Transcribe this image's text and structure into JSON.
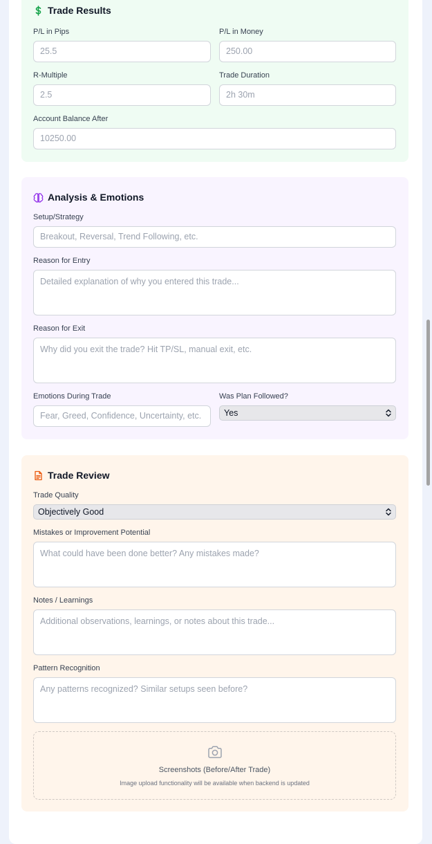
{
  "results": {
    "title": "Trade Results",
    "pl_pips": {
      "label": "P/L in Pips",
      "placeholder": "25.5"
    },
    "pl_money": {
      "label": "P/L in Money",
      "placeholder": "250.00"
    },
    "r_multiple": {
      "label": "R-Multiple",
      "placeholder": "2.5"
    },
    "duration": {
      "label": "Trade Duration",
      "placeholder": "2h 30m"
    },
    "balance": {
      "label": "Account Balance After",
      "placeholder": "10250.00"
    }
  },
  "analysis": {
    "title": "Analysis & Emotions",
    "setup": {
      "label": "Setup/Strategy",
      "placeholder": "Breakout, Reversal, Trend Following, etc."
    },
    "entry_reason": {
      "label": "Reason for Entry",
      "placeholder": "Detailed explanation of why you entered this trade..."
    },
    "exit_reason": {
      "label": "Reason for Exit",
      "placeholder": "Why did you exit the trade? Hit TP/SL, manual exit, etc."
    },
    "emotions": {
      "label": "Emotions During Trade",
      "placeholder": "Fear, Greed, Confidence, Uncertainty, etc."
    },
    "plan_followed": {
      "label": "Was Plan Followed?",
      "value": "Yes"
    }
  },
  "review": {
    "title": "Trade Review",
    "quality": {
      "label": "Trade Quality",
      "value": "Objectively Good"
    },
    "mistakes": {
      "label": "Mistakes or Improvement Potential",
      "placeholder": "What could have been done better? Any mistakes made?"
    },
    "notes": {
      "label": "Notes / Learnings",
      "placeholder": "Additional observations, learnings, or notes about this trade..."
    },
    "patterns": {
      "label": "Pattern Recognition",
      "placeholder": "Any patterns recognized? Similar setups seen before?"
    },
    "screenshots": {
      "title": "Screenshots (Before/After Trade)",
      "note": "Image upload functionality will be available when backend is updated"
    }
  },
  "icons": {
    "results": "dollar-icon",
    "analysis": "brain-icon",
    "review": "document-icon",
    "upload": "camera-icon",
    "select": "chevron-up-down-icon"
  },
  "colors": {
    "results_bg": "#effcf3",
    "analysis_bg": "#f9f4ff",
    "review_bg": "#fff5eb",
    "results_icon": "#16a34a",
    "analysis_icon": "#9333ea",
    "review_icon": "#ea580c"
  }
}
